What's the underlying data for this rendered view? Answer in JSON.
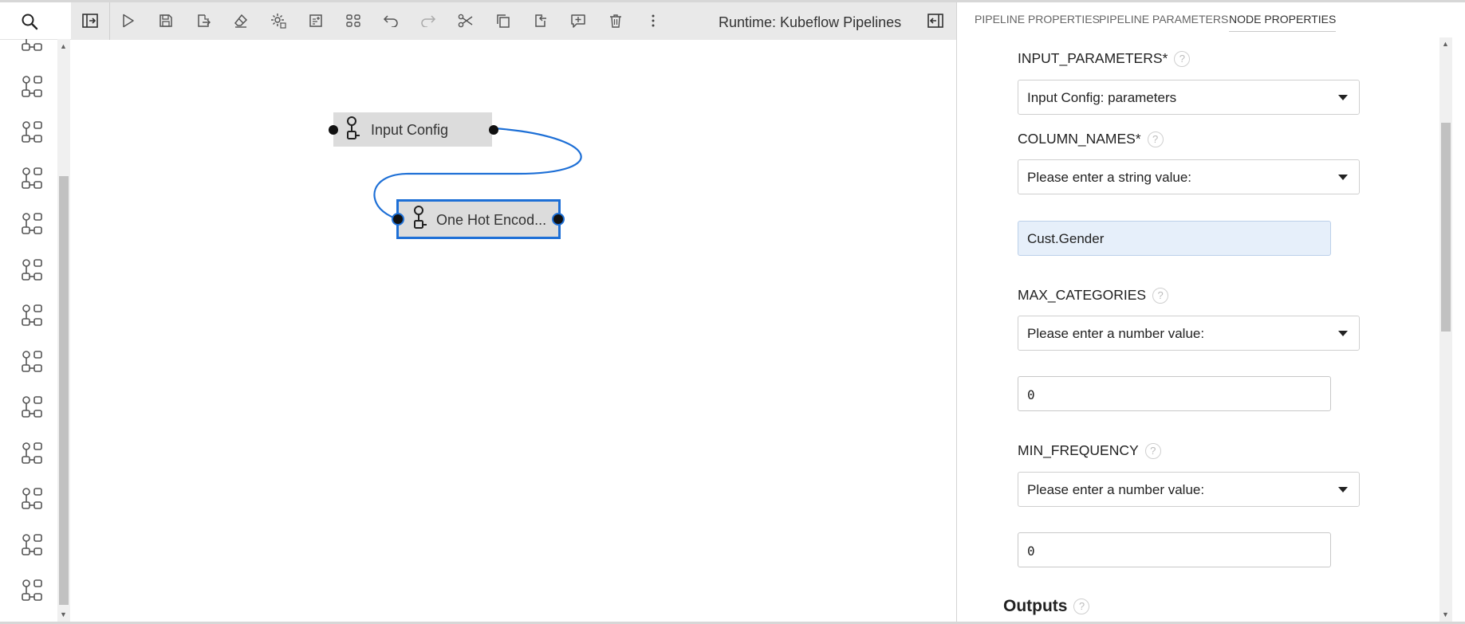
{
  "toolbar": {
    "runtime_label": "Runtime: Kubeflow Pipelines",
    "buttons": [
      "open-panel-icon",
      "run-icon",
      "save-icon",
      "export-icon",
      "clear-icon",
      "settings-icon",
      "add-comment-icon",
      "arrange-icon",
      "undo-icon",
      "redo-icon",
      "cut-icon",
      "copy-icon",
      "paste-icon",
      "comment-icon",
      "delete-icon",
      "more-icon"
    ]
  },
  "palette": {
    "item_icon": "component-node-icon",
    "item_count": 13
  },
  "canvas": {
    "nodes": [
      {
        "label": "Input Config",
        "selected": false
      },
      {
        "label": "One Hot Encod...",
        "selected": true
      }
    ],
    "link_color": "#1d6fd6"
  },
  "panel": {
    "tabs": [
      {
        "label": "PIPELINE PROPERTIES",
        "active": false
      },
      {
        "label": "PIPELINE PARAMETERS",
        "active": false
      },
      {
        "label": "NODE PROPERTIES",
        "active": true
      }
    ],
    "fields": {
      "input_parameters": {
        "label": "INPUT_PARAMETERS*",
        "select": "Input Config: parameters"
      },
      "column_names": {
        "label": "COLUMN_NAMES*",
        "select": "Please enter a string value:",
        "value": "Cust.Gender"
      },
      "max_categories": {
        "label": "MAX_CATEGORIES",
        "select": "Please enter a number value:",
        "value": "0"
      },
      "min_frequency": {
        "label": "MIN_FREQUENCY",
        "select": "Please enter a number value:",
        "value": "0"
      }
    },
    "help_glyph": "?",
    "outputs_heading": "Outputs"
  }
}
